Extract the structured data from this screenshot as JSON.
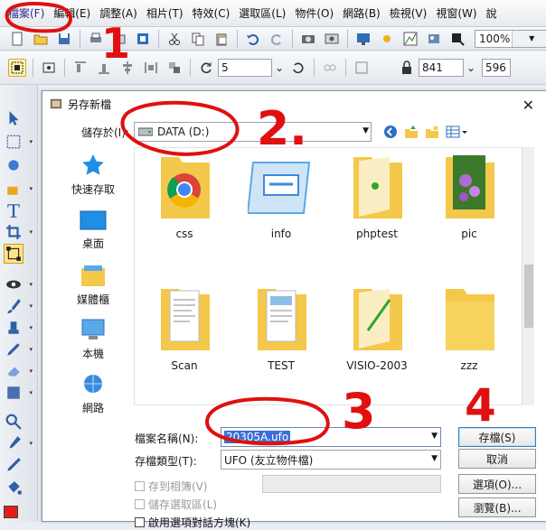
{
  "menubar": {
    "items": [
      "檔案(F)",
      "編輯(E)",
      "調整(A)",
      "相片(T)",
      "特效(C)",
      "選取區(L)",
      "物件(O)",
      "網路(B)",
      "檢視(V)",
      "視窗(W)",
      "說"
    ]
  },
  "toolbar": {
    "zoom": "100%"
  },
  "toolbar2": {
    "rotate_value": "5",
    "width_value": "841",
    "height_value": "596"
  },
  "dialog": {
    "title": "另存新檔",
    "save_in_label": "儲存於(I):",
    "save_in_value": "DATA (D:)",
    "places": [
      "快速存取",
      "桌面",
      "媒體櫃",
      "本機",
      "網路"
    ],
    "files": [
      {
        "name": "css",
        "icon": "folder-chrome-icon"
      },
      {
        "name": "info",
        "icon": "folder-info-icon"
      },
      {
        "name": "phptest",
        "icon": "folder-icon"
      },
      {
        "name": "pic",
        "icon": "folder-photo-icon"
      },
      {
        "name": "Scan",
        "icon": "folder-docs-icon"
      },
      {
        "name": "TEST",
        "icon": "folder-docs-icon"
      },
      {
        "name": "VISIO-2003",
        "icon": "folder-icon"
      },
      {
        "name": "zzz",
        "icon": "folder-icon"
      }
    ],
    "filename_label": "檔案名稱(N):",
    "filename_value": "20305A.ufo",
    "filetype_label": "存檔類型(T):",
    "filetype_value": "UFO (友立物件檔)",
    "save_button": "存檔(S)",
    "cancel_button": "取消",
    "options_button": "選項(O)...",
    "browse_button": "瀏覽(B)...",
    "checkbox_album": "存到相簿(V)",
    "checkbox_selection": "儲存選取區(L)",
    "checkbox_partial": "啟用選項對話方塊(K)"
  },
  "annotations": [
    "1",
    "2.",
    "3",
    "4"
  ],
  "colors": {
    "annotation": "#e01010",
    "selection": "#3a6fd8",
    "folder": "#f4c84a"
  }
}
